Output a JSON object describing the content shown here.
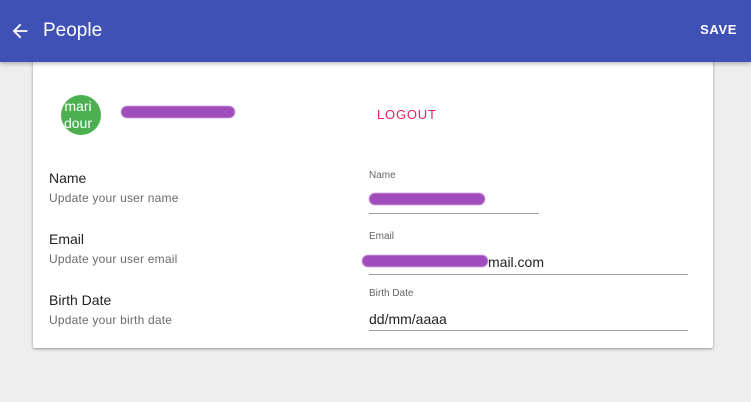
{
  "appbar": {
    "title": "People",
    "save_label": "SAVE",
    "color": "#3f51b5"
  },
  "profile": {
    "avatar_text_line1": "mari",
    "avatar_text_line2": "dour",
    "avatar_color": "#4caf50",
    "logout_label": "LOGOUT",
    "logout_color": "#e91e63"
  },
  "fields": {
    "name": {
      "title": "Name",
      "subtitle": "Update your user name",
      "label": "Name"
    },
    "email": {
      "title": "Email",
      "subtitle": "Update your user email",
      "label": "Email",
      "visible_suffix": "mail.com"
    },
    "birth_date": {
      "title": "Birth Date",
      "subtitle": "Update your birth date",
      "label": "Birth Date",
      "value": "dd/mm/aaaa"
    }
  }
}
